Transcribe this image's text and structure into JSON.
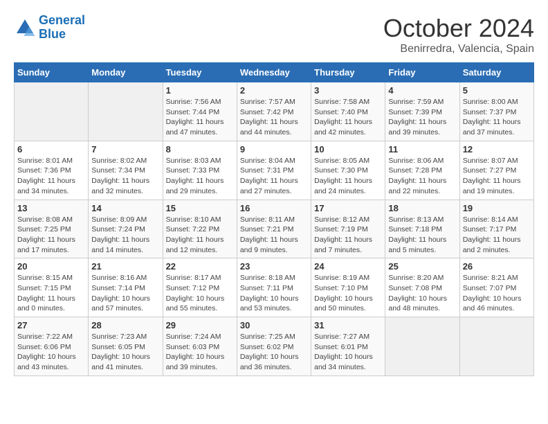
{
  "header": {
    "logo_line1": "General",
    "logo_line2": "Blue",
    "month": "October 2024",
    "location": "Benirredra, Valencia, Spain"
  },
  "weekdays": [
    "Sunday",
    "Monday",
    "Tuesday",
    "Wednesday",
    "Thursday",
    "Friday",
    "Saturday"
  ],
  "weeks": [
    [
      {
        "day": null
      },
      {
        "day": null
      },
      {
        "day": "1",
        "sunrise": "Sunrise: 7:56 AM",
        "sunset": "Sunset: 7:44 PM",
        "daylight": "Daylight: 11 hours and 47 minutes."
      },
      {
        "day": "2",
        "sunrise": "Sunrise: 7:57 AM",
        "sunset": "Sunset: 7:42 PM",
        "daylight": "Daylight: 11 hours and 44 minutes."
      },
      {
        "day": "3",
        "sunrise": "Sunrise: 7:58 AM",
        "sunset": "Sunset: 7:40 PM",
        "daylight": "Daylight: 11 hours and 42 minutes."
      },
      {
        "day": "4",
        "sunrise": "Sunrise: 7:59 AM",
        "sunset": "Sunset: 7:39 PM",
        "daylight": "Daylight: 11 hours and 39 minutes."
      },
      {
        "day": "5",
        "sunrise": "Sunrise: 8:00 AM",
        "sunset": "Sunset: 7:37 PM",
        "daylight": "Daylight: 11 hours and 37 minutes."
      }
    ],
    [
      {
        "day": "6",
        "sunrise": "Sunrise: 8:01 AM",
        "sunset": "Sunset: 7:36 PM",
        "daylight": "Daylight: 11 hours and 34 minutes."
      },
      {
        "day": "7",
        "sunrise": "Sunrise: 8:02 AM",
        "sunset": "Sunset: 7:34 PM",
        "daylight": "Daylight: 11 hours and 32 minutes."
      },
      {
        "day": "8",
        "sunrise": "Sunrise: 8:03 AM",
        "sunset": "Sunset: 7:33 PM",
        "daylight": "Daylight: 11 hours and 29 minutes."
      },
      {
        "day": "9",
        "sunrise": "Sunrise: 8:04 AM",
        "sunset": "Sunset: 7:31 PM",
        "daylight": "Daylight: 11 hours and 27 minutes."
      },
      {
        "day": "10",
        "sunrise": "Sunrise: 8:05 AM",
        "sunset": "Sunset: 7:30 PM",
        "daylight": "Daylight: 11 hours and 24 minutes."
      },
      {
        "day": "11",
        "sunrise": "Sunrise: 8:06 AM",
        "sunset": "Sunset: 7:28 PM",
        "daylight": "Daylight: 11 hours and 22 minutes."
      },
      {
        "day": "12",
        "sunrise": "Sunrise: 8:07 AM",
        "sunset": "Sunset: 7:27 PM",
        "daylight": "Daylight: 11 hours and 19 minutes."
      }
    ],
    [
      {
        "day": "13",
        "sunrise": "Sunrise: 8:08 AM",
        "sunset": "Sunset: 7:25 PM",
        "daylight": "Daylight: 11 hours and 17 minutes."
      },
      {
        "day": "14",
        "sunrise": "Sunrise: 8:09 AM",
        "sunset": "Sunset: 7:24 PM",
        "daylight": "Daylight: 11 hours and 14 minutes."
      },
      {
        "day": "15",
        "sunrise": "Sunrise: 8:10 AM",
        "sunset": "Sunset: 7:22 PM",
        "daylight": "Daylight: 11 hours and 12 minutes."
      },
      {
        "day": "16",
        "sunrise": "Sunrise: 8:11 AM",
        "sunset": "Sunset: 7:21 PM",
        "daylight": "Daylight: 11 hours and 9 minutes."
      },
      {
        "day": "17",
        "sunrise": "Sunrise: 8:12 AM",
        "sunset": "Sunset: 7:19 PM",
        "daylight": "Daylight: 11 hours and 7 minutes."
      },
      {
        "day": "18",
        "sunrise": "Sunrise: 8:13 AM",
        "sunset": "Sunset: 7:18 PM",
        "daylight": "Daylight: 11 hours and 5 minutes."
      },
      {
        "day": "19",
        "sunrise": "Sunrise: 8:14 AM",
        "sunset": "Sunset: 7:17 PM",
        "daylight": "Daylight: 11 hours and 2 minutes."
      }
    ],
    [
      {
        "day": "20",
        "sunrise": "Sunrise: 8:15 AM",
        "sunset": "Sunset: 7:15 PM",
        "daylight": "Daylight: 11 hours and 0 minutes."
      },
      {
        "day": "21",
        "sunrise": "Sunrise: 8:16 AM",
        "sunset": "Sunset: 7:14 PM",
        "daylight": "Daylight: 10 hours and 57 minutes."
      },
      {
        "day": "22",
        "sunrise": "Sunrise: 8:17 AM",
        "sunset": "Sunset: 7:12 PM",
        "daylight": "Daylight: 10 hours and 55 minutes."
      },
      {
        "day": "23",
        "sunrise": "Sunrise: 8:18 AM",
        "sunset": "Sunset: 7:11 PM",
        "daylight": "Daylight: 10 hours and 53 minutes."
      },
      {
        "day": "24",
        "sunrise": "Sunrise: 8:19 AM",
        "sunset": "Sunset: 7:10 PM",
        "daylight": "Daylight: 10 hours and 50 minutes."
      },
      {
        "day": "25",
        "sunrise": "Sunrise: 8:20 AM",
        "sunset": "Sunset: 7:08 PM",
        "daylight": "Daylight: 10 hours and 48 minutes."
      },
      {
        "day": "26",
        "sunrise": "Sunrise: 8:21 AM",
        "sunset": "Sunset: 7:07 PM",
        "daylight": "Daylight: 10 hours and 46 minutes."
      }
    ],
    [
      {
        "day": "27",
        "sunrise": "Sunrise: 7:22 AM",
        "sunset": "Sunset: 6:06 PM",
        "daylight": "Daylight: 10 hours and 43 minutes."
      },
      {
        "day": "28",
        "sunrise": "Sunrise: 7:23 AM",
        "sunset": "Sunset: 6:05 PM",
        "daylight": "Daylight: 10 hours and 41 minutes."
      },
      {
        "day": "29",
        "sunrise": "Sunrise: 7:24 AM",
        "sunset": "Sunset: 6:03 PM",
        "daylight": "Daylight: 10 hours and 39 minutes."
      },
      {
        "day": "30",
        "sunrise": "Sunrise: 7:25 AM",
        "sunset": "Sunset: 6:02 PM",
        "daylight": "Daylight: 10 hours and 36 minutes."
      },
      {
        "day": "31",
        "sunrise": "Sunrise: 7:27 AM",
        "sunset": "Sunset: 6:01 PM",
        "daylight": "Daylight: 10 hours and 34 minutes."
      },
      {
        "day": null
      },
      {
        "day": null
      }
    ]
  ]
}
